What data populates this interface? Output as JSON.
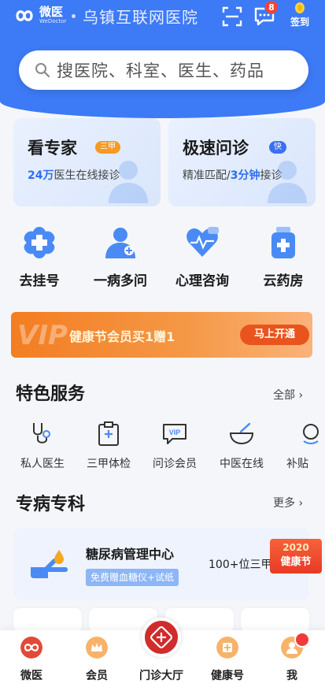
{
  "header": {
    "logo_cn": "微医",
    "logo_en": "WeDoctor",
    "hospital": "乌镇互联网医院",
    "msg_count": "8",
    "signin_label": "签到",
    "colors": {
      "primary": "#3d7af5",
      "badge": "#f44336"
    }
  },
  "search": {
    "placeholder": "搜医院、科室、医生、药品",
    "icon": "search-icon"
  },
  "cards": [
    {
      "title": "看专家",
      "tag": "三甲",
      "sub_bold": "24万",
      "sub_rest": "医生在线接诊",
      "tag_color": "#f59a23"
    },
    {
      "title": "极速问诊",
      "tag": "快",
      "sub_pre": "精准匹配/",
      "sub_bold": "3分钟",
      "sub_rest": "接诊",
      "tag_color": "#3d6ff0"
    }
  ],
  "quick": [
    {
      "label": "去挂号",
      "icon": "hospital-cross-icon"
    },
    {
      "label": "一病多问",
      "icon": "doctor-consult-icon"
    },
    {
      "label": "心理咨询",
      "icon": "heart-chat-icon"
    },
    {
      "label": "云药房",
      "icon": "medicine-bottle-icon"
    }
  ],
  "banner": {
    "vip": "VIP",
    "text": "健康节会员买1赠1",
    "button": "马上开通"
  },
  "featured": {
    "title": "特色服务",
    "more": "全部",
    "items": [
      {
        "label": "私人医生",
        "icon": "stethoscope-icon"
      },
      {
        "label": "三甲体检",
        "icon": "checkup-clipboard-icon"
      },
      {
        "label": "问诊会员",
        "icon": "vip-chat-icon"
      },
      {
        "label": "中医在线",
        "icon": "mortar-bowl-icon"
      },
      {
        "label": "补贴",
        "icon": "subsidy-icon"
      }
    ]
  },
  "specialty": {
    "title": "专病专科",
    "more": "更多",
    "card_title": "糖尿病管理中心",
    "card_tag": "免费赠血糖仪+试纸",
    "card_right": "100+位三甲医",
    "badge_year": "2020",
    "badge_text": "健康节"
  },
  "tabs": [
    {
      "label": "微医",
      "icon": "weyi-logo-icon",
      "active": true
    },
    {
      "label": "会员",
      "icon": "crown-icon"
    },
    {
      "label": "门诊大厅",
      "icon": "clinic-plus-icon"
    },
    {
      "label": "健康号",
      "icon": "health-plus-icon"
    },
    {
      "label": "我",
      "icon": "profile-icon"
    }
  ]
}
